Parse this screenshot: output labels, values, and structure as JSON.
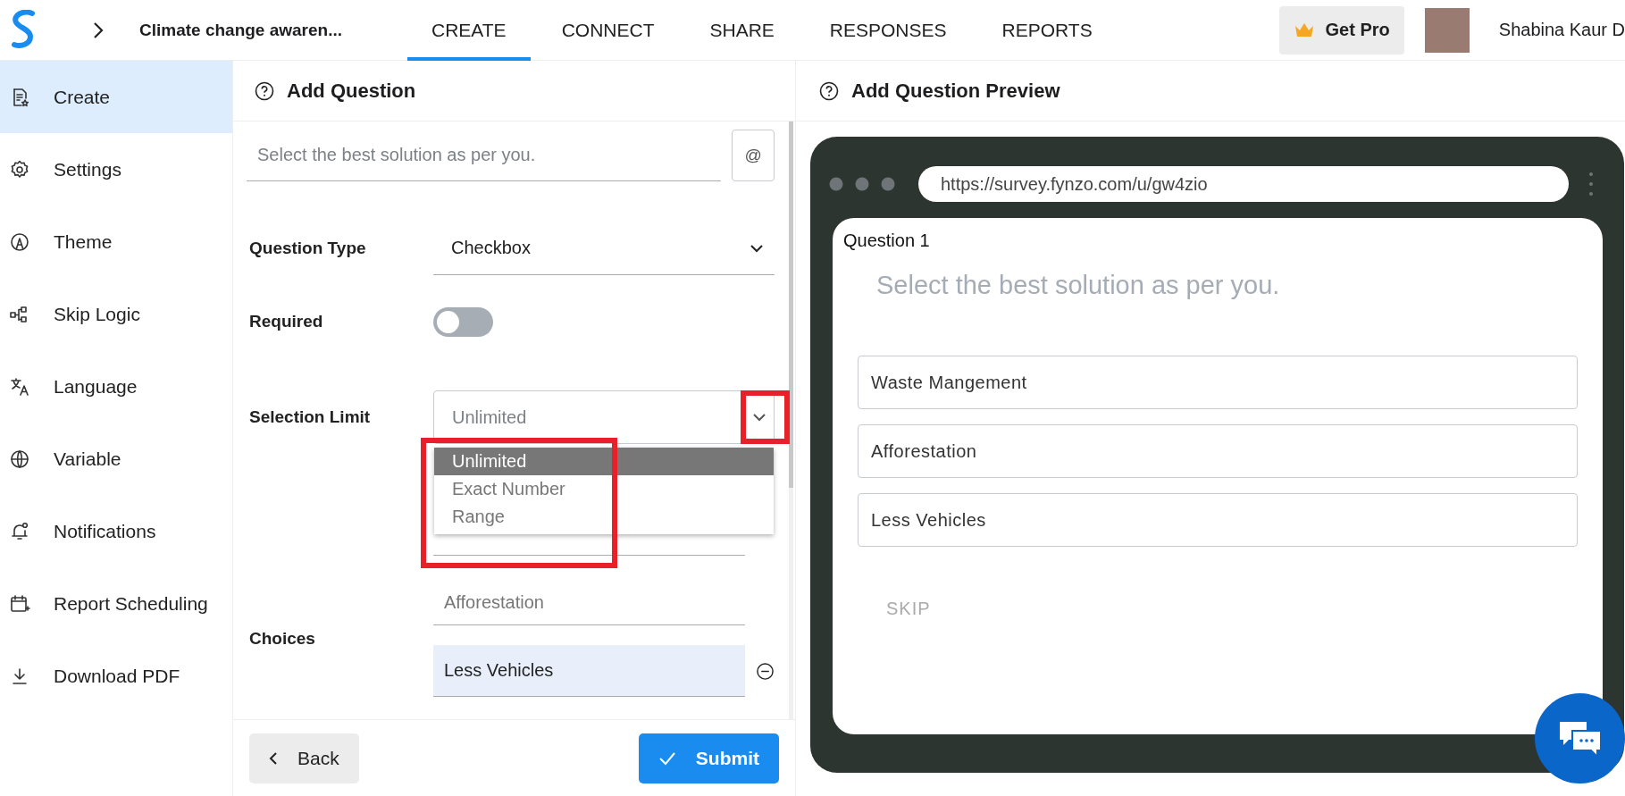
{
  "app": {
    "title": "Climate change awaren...",
    "get_pro": "Get Pro",
    "user": "Shabina Kaur D"
  },
  "tabs": [
    {
      "label": "CREATE",
      "selected": true
    },
    {
      "label": "CONNECT",
      "selected": false
    },
    {
      "label": "SHARE",
      "selected": false
    },
    {
      "label": "RESPONSES",
      "selected": false
    },
    {
      "label": "REPORTS",
      "selected": false
    }
  ],
  "sidebar": {
    "items": [
      {
        "label": "Create",
        "selected": true
      },
      {
        "label": "Settings",
        "selected": false
      },
      {
        "label": "Theme",
        "selected": false
      },
      {
        "label": "Skip Logic",
        "selected": false
      },
      {
        "label": "Language",
        "selected": false
      },
      {
        "label": "Variable",
        "selected": false
      },
      {
        "label": "Notifications",
        "selected": false
      },
      {
        "label": "Report Scheduling",
        "selected": false
      },
      {
        "label": "Download PDF",
        "selected": false
      }
    ]
  },
  "editor": {
    "title": "Add Question",
    "question": {
      "placeholder": "Select the best solution as per you."
    },
    "mention_button": "@",
    "question_type": {
      "label": "Question Type",
      "value": "Checkbox"
    },
    "required": {
      "label": "Required",
      "on": false
    },
    "selection_limit": {
      "label": "Selection Limit",
      "value": "Unlimited",
      "expanded": true,
      "options": [
        {
          "label": "Unlimited",
          "selected": true
        },
        {
          "label": "Exact Number",
          "selected": false
        },
        {
          "label": "Range",
          "selected": false
        }
      ]
    },
    "choices": {
      "label": "Choices",
      "items": [
        {
          "value": "Afforestation",
          "focused": false
        },
        {
          "value": "Less Vehicles",
          "focused": true
        }
      ]
    },
    "back": "Back",
    "submit": "Submit"
  },
  "preview": {
    "title": "Add Question Preview",
    "url": "https://survey.fynzo.com/u/gw4zio",
    "question_number": "Question 1",
    "question": "Select the best solution as per you.",
    "options": [
      "Waste Mangement",
      "Afforestation",
      "Less Vehicles"
    ],
    "skip": "SKIP"
  }
}
